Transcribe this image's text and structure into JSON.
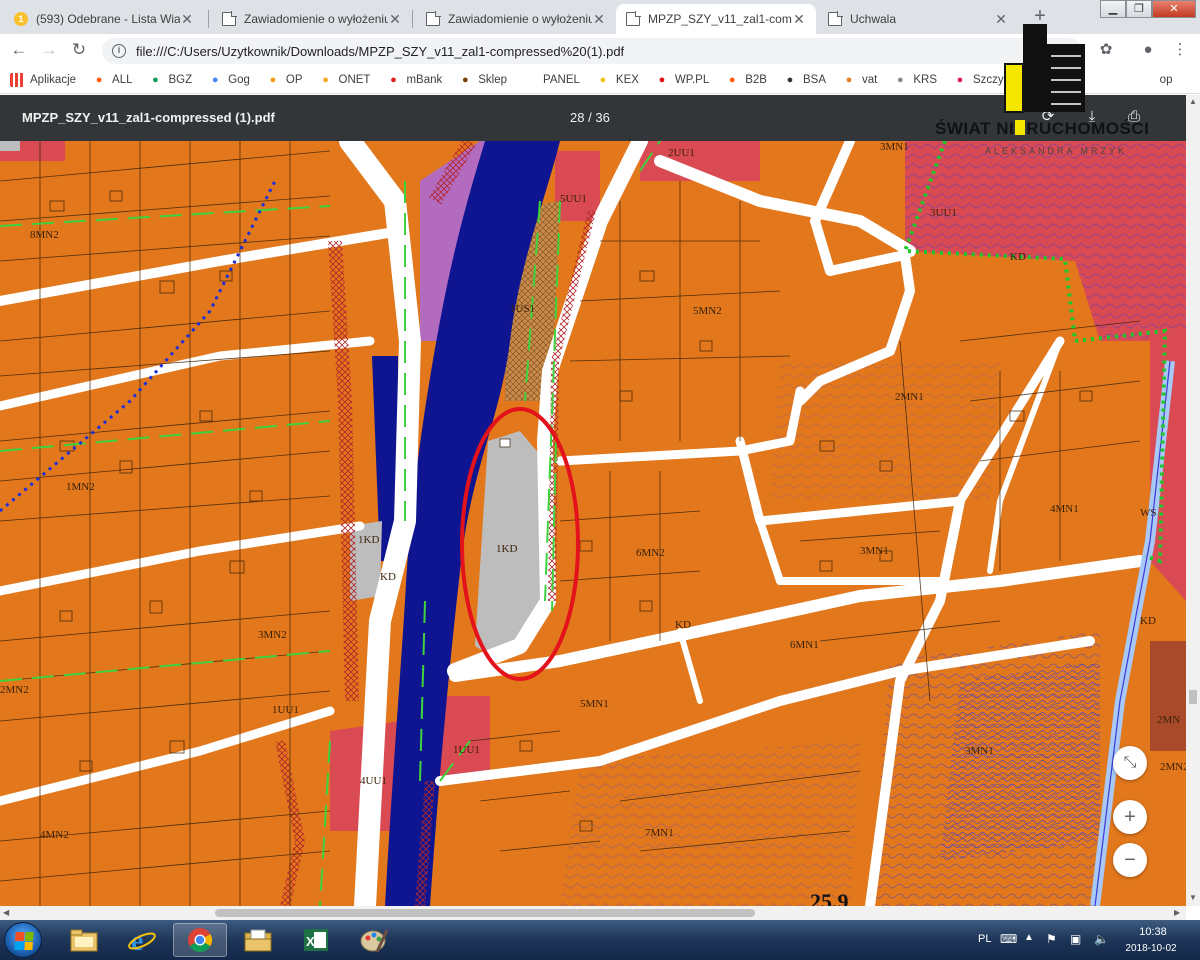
{
  "browser": {
    "tabs": [
      {
        "title": "(593) Odebrane - Lista Wiad",
        "icon": "mail-icon",
        "badge": "1"
      },
      {
        "title": "Zawiadomienie o wyłożeniu",
        "icon": "document-icon"
      },
      {
        "title": "Zawiadomienie o wyłożeniu",
        "icon": "document-icon"
      },
      {
        "title": "MPZP_SZY_v11_zal1-compre",
        "icon": "document-icon",
        "active": true
      },
      {
        "title": "Uchwala",
        "icon": "document-icon"
      }
    ],
    "url": "file:///C:/Users/Uzytkownik/Downloads/MPZP_SZY_v11_zal1-compressed%20(1).pdf",
    "bookmarks": [
      {
        "label": "Aplikacje",
        "icon": "apps-icon",
        "color": "#e94235"
      },
      {
        "label": "ALL",
        "icon": "a-icon",
        "color": "#ff5a00"
      },
      {
        "label": "BGZ",
        "icon": "bgz-icon",
        "color": "#0f9d58"
      },
      {
        "label": "Gog",
        "icon": "google-icon",
        "color": "#4285f4"
      },
      {
        "label": "OP",
        "icon": "op-icon",
        "color": "#f39c12"
      },
      {
        "label": "ONET",
        "icon": "onet-icon",
        "color": "#f5a623"
      },
      {
        "label": "mBank",
        "icon": "mbank-icon",
        "color": "#e2231a"
      },
      {
        "label": "Sklep",
        "icon": "sklep-icon",
        "color": "#7b3f00"
      },
      {
        "label": "PANEL",
        "icon": "panel-icon",
        "color": "#ffffff"
      },
      {
        "label": "KEX",
        "icon": "kex-icon",
        "color": "#f4c20d"
      },
      {
        "label": "WP.PL",
        "icon": "wp-icon",
        "color": "#e30613"
      },
      {
        "label": "B2B",
        "icon": "b2b-icon",
        "color": "#ff5a00"
      },
      {
        "label": "BSA",
        "icon": "bsa-icon",
        "color": "#333333"
      },
      {
        "label": "vat",
        "icon": "vat-icon",
        "color": "#e67e22"
      },
      {
        "label": "KRS",
        "icon": "krs-icon",
        "color": "#888888"
      },
      {
        "label": "Szczy",
        "icon": "szczy-icon",
        "color": "#d81b60"
      }
    ],
    "bookmarks_tail": "op"
  },
  "pdf": {
    "filename": "MPZP_SZY_v11_zal1-compressed (1).pdf",
    "page_current": "28",
    "page_separator": "/",
    "page_total": "36"
  },
  "map": {
    "labels": [
      "8MN2",
      "2UU1",
      "3MN1",
      "5UU1",
      "3UU1",
      "KD",
      "1US1",
      "5MN2",
      "2MN1",
      "1MN2",
      "1KD",
      "KD",
      "1KD",
      "6MN2",
      "4MN1",
      "3MN1",
      "3MN2",
      "KD",
      "6MN1",
      "2MN2",
      "1UU1",
      "5MN1",
      "WS",
      "1UU1",
      "4UU1",
      "3MN1",
      "2MN",
      "4MN2",
      "7MN1",
      "KD",
      "2MN2"
    ],
    "scale_text": "25.9"
  },
  "watermark": {
    "brand_prefix": "ŚWIAT NI",
    "brand_suffix": "RUCHOMOŚCI",
    "subtitle": "ALEKSANDRA MRZYK"
  },
  "taskbar": {
    "apps": [
      "explorer-icon",
      "internet-explorer-icon",
      "chrome-icon",
      "folder-icon",
      "excel-icon",
      "paint-icon"
    ],
    "language": "PL",
    "time": "10:38",
    "date": "2018-10-02"
  }
}
